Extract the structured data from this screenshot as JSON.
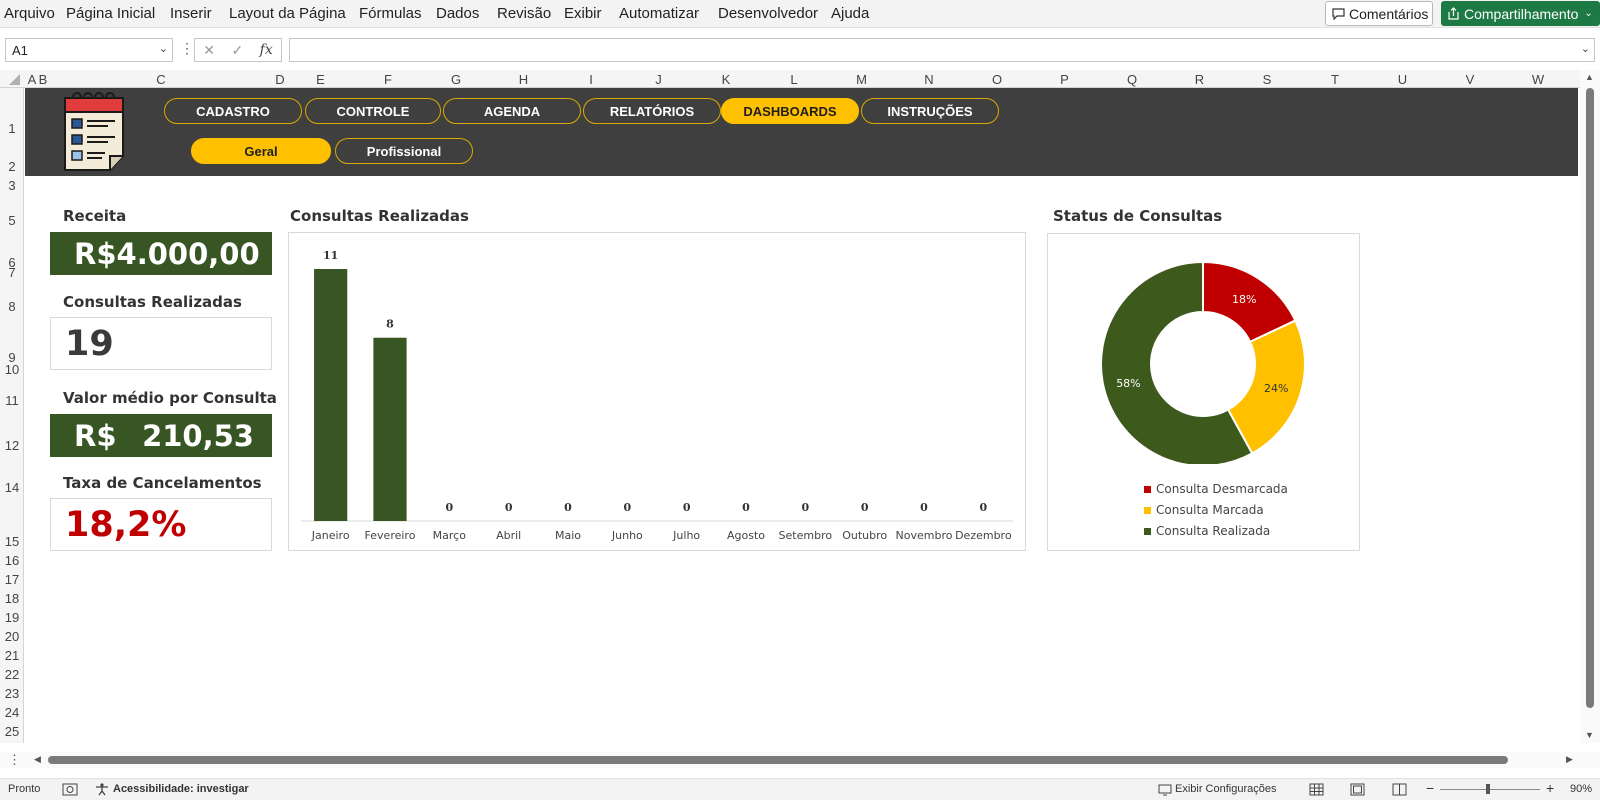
{
  "menu": {
    "items": [
      "Arquivo",
      "Página Inicial",
      "Inserir",
      "Layout da Página",
      "Fórmulas",
      "Dados",
      "Revisão",
      "Exibir",
      "Automatizar",
      "Desenvolvedor",
      "Ajuda"
    ],
    "comments_label": "Comentários",
    "share_label": "Compartilhamento"
  },
  "formula_bar": {
    "name_box": "A1",
    "fx_label": "fx",
    "formula": ""
  },
  "sheet": {
    "columns": [
      "A",
      "B",
      "C",
      "D",
      "E",
      "F",
      "G",
      "H",
      "I",
      "J",
      "K",
      "L",
      "M",
      "N",
      "O",
      "P",
      "Q",
      "R",
      "S",
      "T",
      "U",
      "V",
      "W"
    ],
    "rows": [
      "1",
      "2",
      "3",
      "5",
      "6",
      "7",
      "8",
      "9",
      "10",
      "11",
      "12",
      "14",
      "15",
      "16",
      "17",
      "18",
      "19",
      "20",
      "21",
      "22",
      "23",
      "24",
      "25"
    ]
  },
  "nav": {
    "main": [
      "CADASTRO",
      "CONTROLE",
      "AGENDA",
      "RELATÓRIOS",
      "DASHBOARDS",
      "INSTRUÇÕES"
    ],
    "active_main": "DASHBOARDS",
    "sub": [
      "Geral",
      "Profissional"
    ],
    "active_sub": "Geral"
  },
  "kpis": {
    "revenue": {
      "title": "Receita",
      "currency": "R$",
      "value": "4.000,00"
    },
    "consultations": {
      "title": "Consultas Realizadas",
      "value": "19"
    },
    "avg_value": {
      "title": "Valor médio por Consulta",
      "currency": "R$",
      "value": "210,53"
    },
    "cancel_rate": {
      "title": "Taxa de Cancelamentos",
      "value": "18,2%"
    }
  },
  "colors": {
    "dark_green": "#375623",
    "donut_green": "#3d5a1c",
    "yellow": "#ffc000",
    "red": "#c00000",
    "band": "#3f3f3f",
    "cancel_red": "#c00000"
  },
  "chart_data": [
    {
      "type": "bar",
      "title": "Consultas Realizadas",
      "categories": [
        "Janeiro",
        "Fevereiro",
        "Março",
        "Abril",
        "Maio",
        "Junho",
        "Julho",
        "Agosto",
        "Setembro",
        "Outubro",
        "Novembro",
        "Dezembro"
      ],
      "values": [
        11,
        8,
        0,
        0,
        0,
        0,
        0,
        0,
        0,
        0,
        0,
        0
      ],
      "ylim": [
        0,
        11
      ],
      "data_labels": true,
      "grid": false
    },
    {
      "type": "pie",
      "title": "Status de Consultas",
      "donut": true,
      "labels": [
        "Consulta Desmarcada",
        "Consulta Marcada",
        "Consulta Realizada"
      ],
      "values": [
        18,
        24,
        58
      ],
      "value_labels": [
        "18%",
        "24%",
        "58%"
      ],
      "colors": [
        "#c00000",
        "#ffc000",
        "#3d5a1c"
      ],
      "legend_position": "bottom"
    }
  ],
  "status_bar": {
    "ready": "Pronto",
    "accessibility": "Acessibilidade: investigar",
    "display_settings": "Exibir Configurações",
    "zoom": "90%"
  }
}
